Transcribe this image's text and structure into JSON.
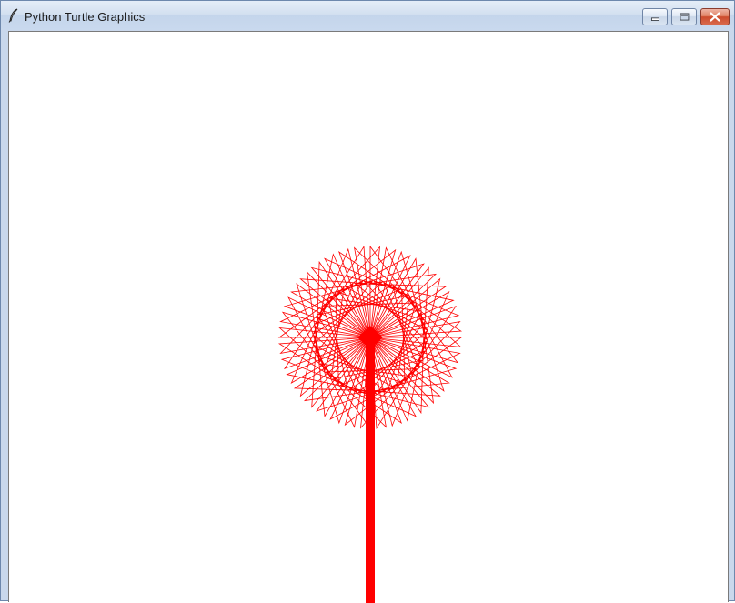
{
  "window": {
    "title": "Python Turtle Graphics",
    "app_icon": "feather-icon",
    "buttons": {
      "minimize": "minimize-icon",
      "maximize": "maximize-icon",
      "close": "close-icon"
    }
  },
  "drawing": {
    "pen_color": "#ff0000",
    "background": "#ffffff",
    "star_points": 36,
    "star_repeats": 36
  }
}
